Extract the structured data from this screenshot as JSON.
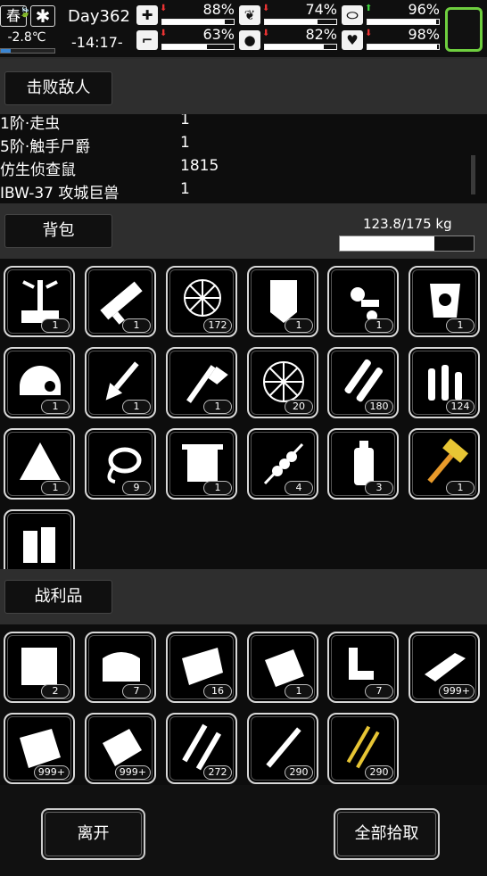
{
  "hud": {
    "season": "春",
    "weather_icon": "snowflake-icon",
    "temperature": "-2.8℃",
    "temperature_level": 0.18,
    "day": "Day362",
    "time": "-14:17-",
    "stats": [
      {
        "name": "health",
        "icon": "medkit-icon",
        "trend": "down",
        "value": "88%",
        "level": 0.88
      },
      {
        "name": "hunger",
        "icon": "stomach-icon",
        "trend": "down",
        "value": "74%",
        "level": 0.74
      },
      {
        "name": "sanity",
        "icon": "pill-icon",
        "trend": "up",
        "value": "96%",
        "level": 0.96
      },
      {
        "name": "stamina",
        "icon": "boot-icon",
        "trend": "down",
        "value": "63%",
        "level": 0.63
      },
      {
        "name": "thirst",
        "icon": "water-drop-icon",
        "trend": "down",
        "value": "82%",
        "level": 0.82
      },
      {
        "name": "mood",
        "icon": "heart-icon",
        "trend": "down",
        "value": "98%",
        "level": 0.98
      }
    ]
  },
  "kills": {
    "label": "击败敌人",
    "rows": [
      {
        "name": "1阶·走虫",
        "count": "1"
      },
      {
        "name": "5阶·触手尸爵",
        "count": "1"
      },
      {
        "name": "仿生侦查鼠",
        "count": "1815"
      },
      {
        "name": "IBW-37 攻城巨兽",
        "count": "1"
      }
    ]
  },
  "backpack": {
    "label": "背包",
    "weight": "123.8/175 kg",
    "weight_level": 0.707,
    "items": [
      {
        "icon": "workbench-icon",
        "count": "1"
      },
      {
        "icon": "minigun-icon",
        "count": "1"
      },
      {
        "icon": "net-trap-icon",
        "count": "172"
      },
      {
        "icon": "riot-shield-icon",
        "count": "1"
      },
      {
        "icon": "parts-icon",
        "count": "1"
      },
      {
        "icon": "armor-icon",
        "count": "1"
      },
      {
        "icon": "helmet-icon",
        "count": "1"
      },
      {
        "icon": "shovel-icon",
        "count": "1"
      },
      {
        "icon": "axe-icon",
        "count": "1"
      },
      {
        "icon": "net-icon",
        "count": "20"
      },
      {
        "icon": "bullets-icon",
        "count": "180"
      },
      {
        "icon": "rifle-ammo-icon",
        "count": "124"
      },
      {
        "icon": "rice-ball-icon",
        "count": "1"
      },
      {
        "icon": "rope-icon",
        "count": "9"
      },
      {
        "icon": "towel-icon",
        "count": "1"
      },
      {
        "icon": "skewer-icon",
        "count": "4"
      },
      {
        "icon": "water-bottle-icon",
        "count": "3"
      },
      {
        "icon": "hammer-icon",
        "count": "1"
      },
      {
        "icon": "battery-icon",
        "count": ""
      }
    ]
  },
  "loot": {
    "label": "战利品",
    "items": [
      {
        "icon": "cloth-icon",
        "count": "2"
      },
      {
        "icon": "fabric-stack-icon",
        "count": "7"
      },
      {
        "icon": "raw-meat-icon",
        "count": "16"
      },
      {
        "icon": "paper-icon",
        "count": "1"
      },
      {
        "icon": "scrap-parts-icon",
        "count": "7"
      },
      {
        "icon": "iron-plate-icon",
        "count": "999+"
      },
      {
        "icon": "plastic-sheet-icon",
        "count": "999+"
      },
      {
        "icon": "metal-sheet-icon",
        "count": "999+"
      },
      {
        "icon": "screws-icon",
        "count": "272"
      },
      {
        "icon": "pipe-icon",
        "count": "290"
      },
      {
        "icon": "gold-wire-icon",
        "count": "290"
      }
    ]
  },
  "actions": {
    "leave": "离开",
    "take_all": "全部拾取"
  }
}
